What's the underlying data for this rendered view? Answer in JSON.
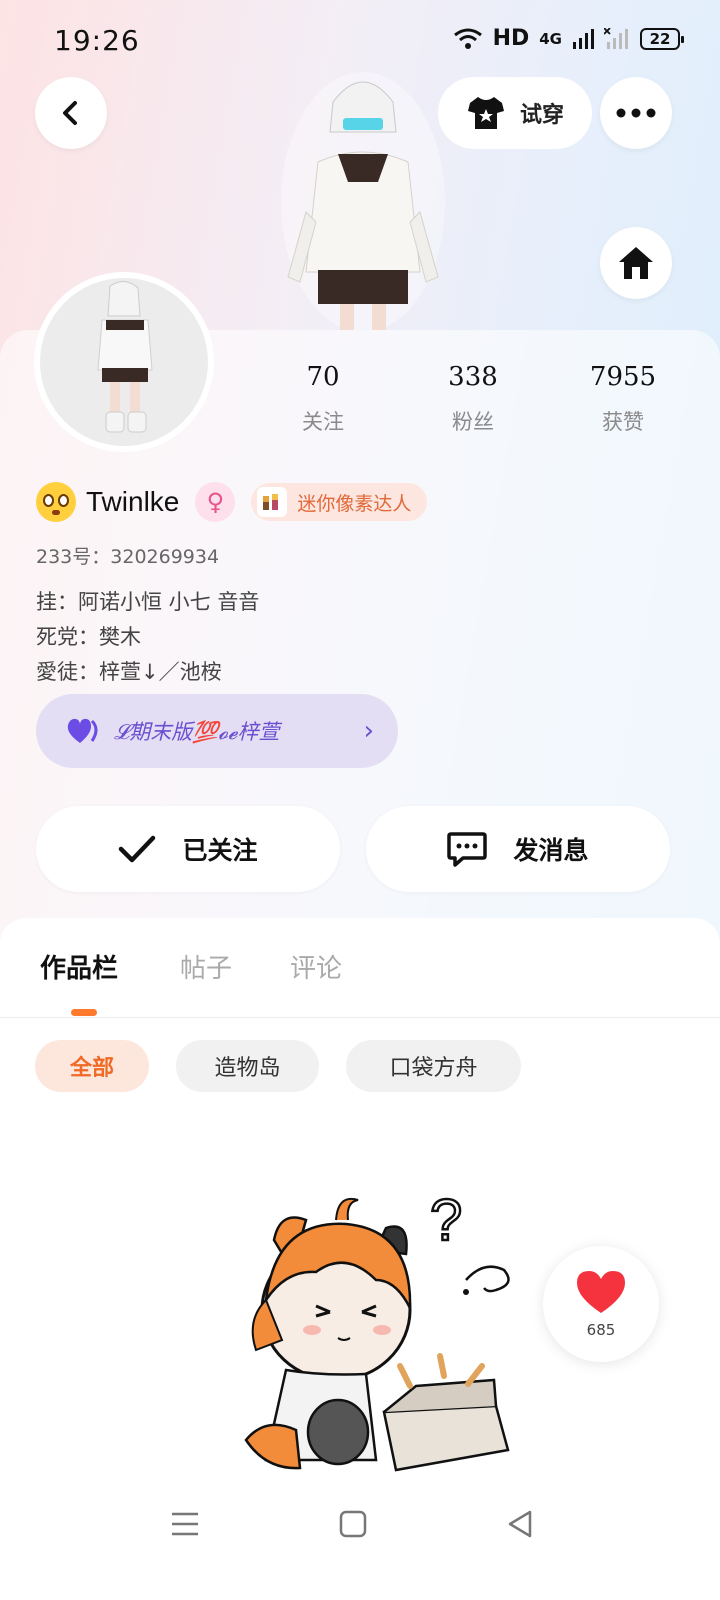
{
  "status_bar": {
    "time": "19:26",
    "network": "HD",
    "cell": "4G",
    "battery": "22"
  },
  "header": {
    "back_icon": "chevron-left-icon",
    "tryon_label": "试穿",
    "more_icon": "more-dots-icon",
    "home_icon": "home-icon"
  },
  "stats": [
    {
      "value": "70",
      "label": "关注"
    },
    {
      "value": "338",
      "label": "粉丝"
    },
    {
      "value": "7955",
      "label": "获赞"
    }
  ],
  "profile": {
    "username": "Twinlke",
    "gender_symbol": "♀",
    "title_badge": "迷你像素达人",
    "uid": "233号：320269934",
    "bio": [
      "挂：阿诺小恒 小七 音音",
      "死党：樊木",
      "愛徒：梓萱↓／池桉"
    ],
    "guild_name": "𝓛期末版💯𝓸𝓮梓萱"
  },
  "actions": {
    "follow_label": "已关注",
    "message_label": "发消息"
  },
  "tabs": [
    {
      "label": "作品栏",
      "active": true
    },
    {
      "label": "帖子",
      "active": false
    },
    {
      "label": "评论",
      "active": false
    }
  ],
  "filters": [
    {
      "label": "全部",
      "active": true
    },
    {
      "label": "造物岛",
      "active": false
    },
    {
      "label": "口袋方舟",
      "active": false
    }
  ],
  "like_fab": {
    "count": "685"
  },
  "colors": {
    "accent": "#ff7a2d",
    "guild": "#6a4fd0",
    "heart": "#f5333f"
  }
}
